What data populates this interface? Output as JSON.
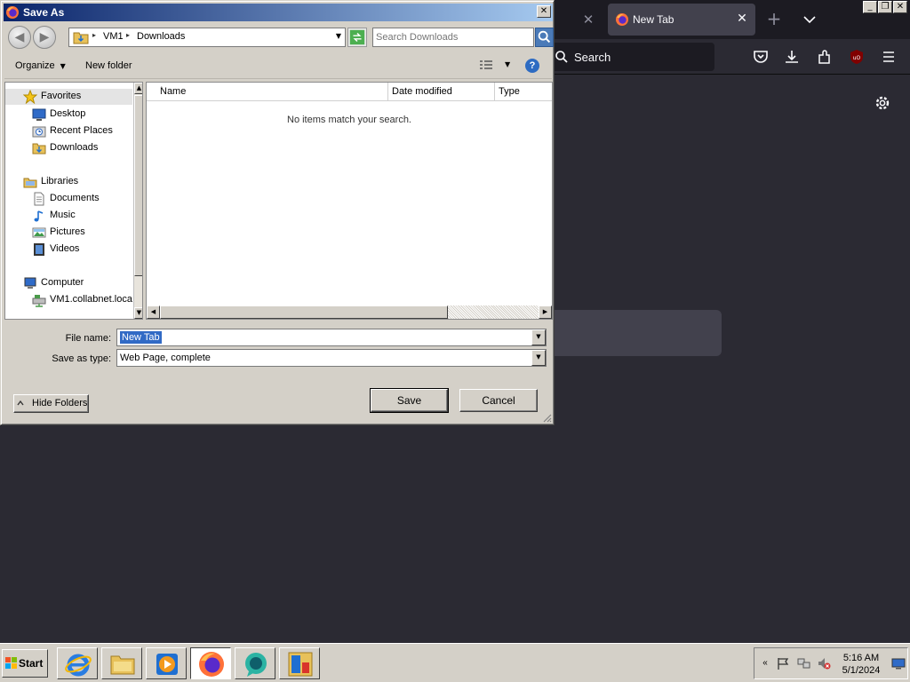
{
  "browser": {
    "tab_title": "New Tab",
    "close_symbol": "✕",
    "new_tab_symbol": "+",
    "urlbar_text": "Search",
    "window_controls": [
      "_",
      "❐",
      "✕"
    ],
    "icons": [
      "firefox-icon",
      "search-icon",
      "pocket-icon",
      "downloads-icon",
      "extensions-icon",
      "ublock-icon",
      "menu-icon",
      "settings-gear-icon"
    ]
  },
  "dialog": {
    "title": "Save As",
    "close_symbol": "✕",
    "address": {
      "crumbs": [
        "VM1",
        "Downloads"
      ],
      "separator": "▸",
      "dropdown": "▼"
    },
    "search_placeholder": "Search Downloads",
    "toolbar": {
      "organize": "Organize",
      "new_folder": "New folder",
      "help": "?",
      "arrow": "▼"
    },
    "nav_tree": {
      "favorites": "Favorites",
      "desktop": "Desktop",
      "recent_places": "Recent Places",
      "downloads": "Downloads",
      "libraries": "Libraries",
      "documents": "Documents",
      "music": "Music",
      "pictures": "Pictures",
      "videos": "Videos",
      "computer": "Computer",
      "network_drive": "VM1.collabnet.loca"
    },
    "columns": [
      "Name",
      "Date modified",
      "Type"
    ],
    "sort_arrow": "˄",
    "empty_message": "No items match your search.",
    "file_name_label": "File name:",
    "file_name_value": "New Tab",
    "save_type_label": "Save as type:",
    "save_type_value": "Web Page, complete",
    "hide_folders": "Hide Folders",
    "save_button": "Save",
    "cancel_button": "Cancel",
    "scroll_up": "▲",
    "scroll_down": "▼",
    "scroll_left": "◀",
    "scroll_right": "▶"
  },
  "taskbar": {
    "start_label": "Start",
    "apps": [
      "internet-explorer-icon",
      "file-explorer-icon",
      "media-player-icon",
      "firefox-icon",
      "chat-app-icon",
      "installer-icon"
    ],
    "active_app": "firefox-icon",
    "time": "5:16 AM",
    "date": "5/1/2024",
    "tray_expand": "«"
  },
  "colors": {
    "browser_bg": "#2b2a33",
    "tabstrip_bg": "#1c1b22",
    "dialog_face": "#d4d0c8",
    "title_gradient_start": "#0a246a",
    "selection_blue": "#316ac5"
  }
}
